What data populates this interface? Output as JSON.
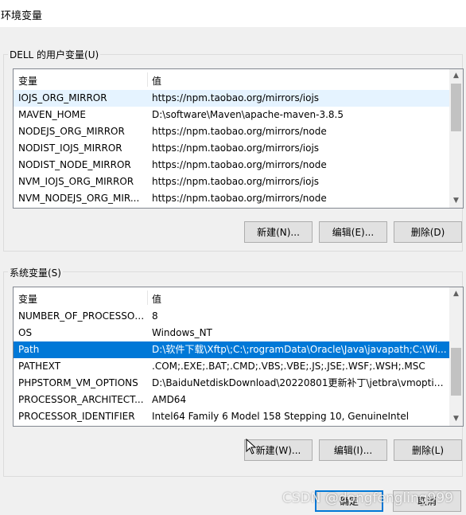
{
  "window": {
    "title": "环境变量"
  },
  "user_group": {
    "label": "DELL 的用户变量(U)"
  },
  "system_group": {
    "label": "系统变量(S)"
  },
  "columns": {
    "variable": "变量",
    "value": "值"
  },
  "user_vars": [
    {
      "name": "IOJS_ORG_MIRROR",
      "value": "https://npm.taobao.org/mirrors/iojs"
    },
    {
      "name": "MAVEN_HOME",
      "value": "D:\\software\\Maven\\apache-maven-3.8.5"
    },
    {
      "name": "NODEJS_ORG_MIRROR",
      "value": "https://npm.taobao.org/mirrors/node"
    },
    {
      "name": "NODIST_IOJS_MIRROR",
      "value": "https://npm.taobao.org/mirrors/iojs"
    },
    {
      "name": "NODIST_NODE_MIRROR",
      "value": "https://npm.taobao.org/mirrors/node"
    },
    {
      "name": "NVM_IOJS_ORG_MIRROR",
      "value": "https://npm.taobao.org/mirrors/iojs"
    },
    {
      "name": "NVM_NODEJS_ORG_MIR...",
      "value": "https://npm.taobao.org/mirrors/node"
    }
  ],
  "system_vars": [
    {
      "name": "NUMBER_OF_PROCESSORS",
      "value": "8"
    },
    {
      "name": "OS",
      "value": "Windows_NT"
    },
    {
      "name": "Path",
      "value": "D:\\软件下载\\Xftp\\;C:\\;rogramData\\Oracle\\Java\\javapath;C:\\Wi..."
    },
    {
      "name": "PATHEXT",
      "value": ".COM;.EXE;.BAT;.CMD;.VBS;.VBE;.JS;.JSE;.WSF;.WSH;.MSC"
    },
    {
      "name": "PHPSTORM_VM_OPTIONS",
      "value": "D:\\BaiduNetdiskDownload\\20220801更新补丁\\jetbra\\vmoptio..."
    },
    {
      "name": "PROCESSOR_ARCHITECT...",
      "value": "AMD64"
    },
    {
      "name": "PROCESSOR_IDENTIFIER",
      "value": "Intel64 Family 6 Model 158 Stepping 10, GenuineIntel"
    }
  ],
  "user_buttons": {
    "new": "新建(N)...",
    "edit": "编辑(E)...",
    "delete": "删除(D)"
  },
  "system_buttons": {
    "new": "新建(W)...",
    "edit": "编辑(I)...",
    "delete": "删除(L)"
  },
  "footer_buttons": {
    "ok": "确定",
    "cancel": "取消"
  },
  "watermark": "CSDN @dongfengling999",
  "state": {
    "user_hover_row": 0,
    "system_selected_row": 2
  },
  "colors": {
    "selection": "#0078d7",
    "hover": "#e5f3ff",
    "default_button_border": "#0078d7"
  }
}
